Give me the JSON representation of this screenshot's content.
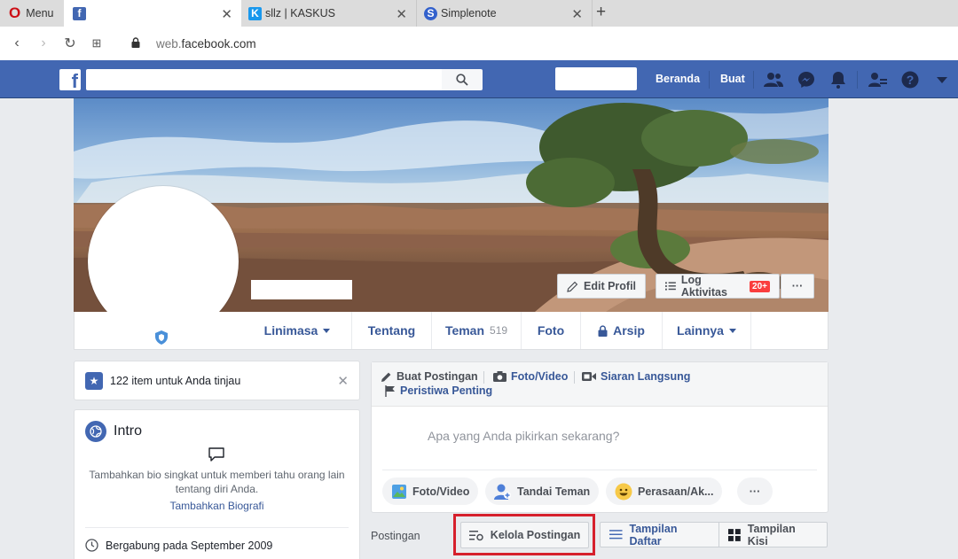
{
  "browser": {
    "menu_label": "Menu",
    "tabs": [
      {
        "label": ""
      },
      {
        "label": "sllz | KASKUS"
      },
      {
        "label": "Simplenote"
      }
    ],
    "url_host": "web.",
    "url_domain": "facebook.com"
  },
  "topbar": {
    "home_label": "Beranda",
    "create_label": "Buat",
    "search_placeholder": ""
  },
  "cover": {
    "edit_profile": "Edit Profil",
    "activity_log": "Log Aktivitas",
    "activity_badge": "20+",
    "more": "···"
  },
  "profile_nav": {
    "timeline": "Linimasa",
    "about": "Tentang",
    "friends": "Teman",
    "friends_count": "519",
    "photos": "Foto",
    "archive": "Arsip",
    "more": "Lainnya"
  },
  "review": {
    "text": "122 item untuk Anda tinjau",
    "close": "✕"
  },
  "intro": {
    "title": "Intro",
    "bio_prompt": "Tambahkan bio singkat untuk memberi tahu orang lain tentang diri Anda.",
    "add_bio": "Tambahkan Biografi",
    "joined": "Bergabung pada September 2009"
  },
  "composer": {
    "tab_post": "Buat Postingan",
    "tab_photo": "Foto/Video",
    "tab_live": "Siaran Langsung",
    "tab_event": "Peristiwa Penting",
    "placeholder": "Apa yang Anda pikirkan sekarang?",
    "action_photo": "Foto/Video",
    "action_tag": "Tandai Teman",
    "action_feeling": "Perasaan/Ak...",
    "action_more": "···"
  },
  "posts": {
    "label": "Postingan",
    "manage": "Kelola Postingan",
    "list_view": "Tampilan Daftar",
    "grid_view": "Tampilan Kisi"
  },
  "colors": {
    "fb_blue": "#4267b2",
    "link_blue": "#385898",
    "highlight_red": "#d6202c",
    "badge_red": "#fa3e3e"
  }
}
